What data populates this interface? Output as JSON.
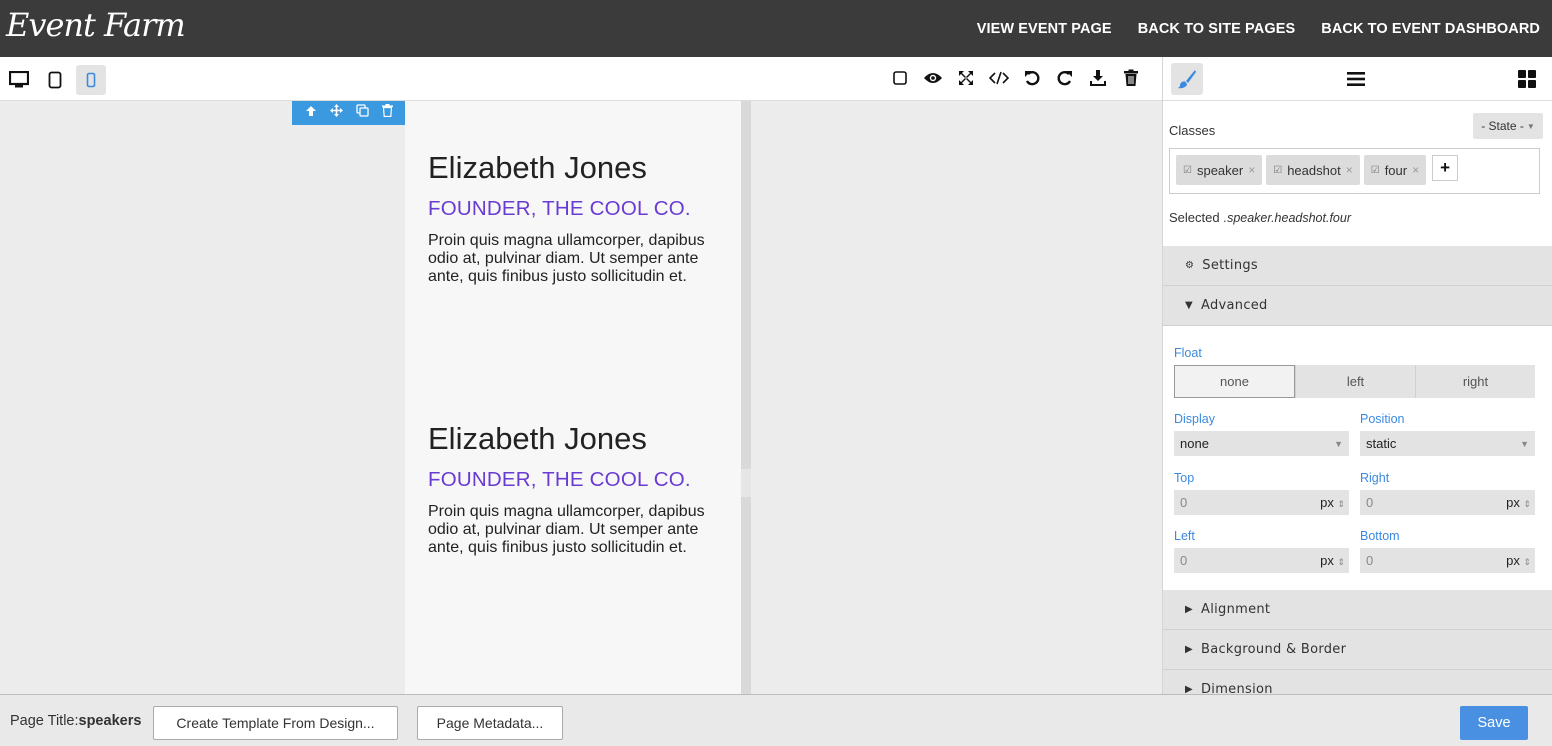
{
  "header": {
    "logo": "Event Farm",
    "nav": [
      "VIEW EVENT PAGE",
      "BACK TO SITE PAGES",
      "BACK TO EVENT DASHBOARD"
    ]
  },
  "toolbar": {
    "devices": [
      "desktop-icon",
      "tablet-icon",
      "mobile-icon"
    ],
    "active_device": "mobile",
    "actions": [
      "square-outline-icon",
      "eye-icon",
      "fullscreen-icon",
      "code-icon",
      "undo-icon",
      "redo-icon",
      "download-icon",
      "trash-icon"
    ]
  },
  "panel_header": {
    "buttons": [
      "paintbrush-icon",
      "menu-icon",
      "blocks-icon"
    ]
  },
  "canvas": {
    "speakers": [
      {
        "name": "Elizabeth Jones",
        "role": "FOUNDER, THE COOL CO.",
        "bio": "Proin quis magna ullamcorper, dapibus odio at, pulvinar diam. Ut semper ante ante, quis finibus justo sollicitudin et."
      },
      {
        "name": "Elizabeth Jones",
        "role": "FOUNDER, THE COOL CO.",
        "bio": "Proin quis magna ullamcorper, dapibus odio at, pulvinar diam. Ut semper ante ante, quis finibus justo sollicitudin et."
      }
    ]
  },
  "panel": {
    "classes_label": "Classes",
    "state_label": "- State -",
    "tags": [
      "speaker",
      "headshot",
      "four"
    ],
    "add_label": "+",
    "selected_label": "Selected",
    "selected_value": ".speaker.headshot.four",
    "sections": {
      "settings": "Settings",
      "advanced": "Advanced",
      "alignment": "Alignment",
      "background": "Background & Border",
      "dimension": "Dimension"
    },
    "float": {
      "label": "Float",
      "options": [
        "none",
        "left",
        "right"
      ],
      "selected": "none"
    },
    "display": {
      "label": "Display",
      "value": "none"
    },
    "position": {
      "label": "Position",
      "value": "static"
    },
    "top": {
      "label": "Top",
      "value": "0",
      "unit": "px"
    },
    "right": {
      "label": "Right",
      "value": "0",
      "unit": "px"
    },
    "left": {
      "label": "Left",
      "value": "0",
      "unit": "px"
    },
    "bottom": {
      "label": "Bottom",
      "value": "0",
      "unit": "px"
    }
  },
  "footer": {
    "page_title_label": "Page Title:",
    "page_title_value": "speakers",
    "create_template": "Create Template From Design...",
    "page_metadata": "Page Metadata...",
    "save": "Save"
  }
}
